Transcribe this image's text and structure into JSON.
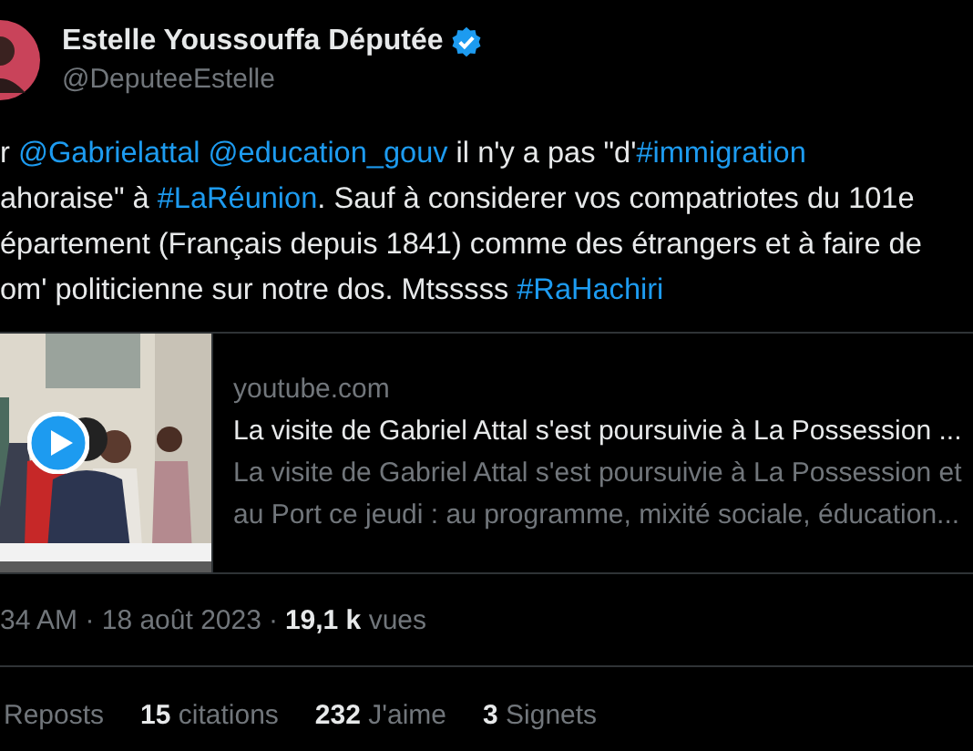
{
  "author": {
    "name": "Estelle Youssouffa Députée",
    "verified": true,
    "handle": "@DeputeeEstelle"
  },
  "tweet_lines": [
    [
      {
        "kind": "text",
        "text": "r "
      },
      {
        "kind": "mention",
        "text": "@Gabrielattal"
      },
      {
        "kind": "mention",
        "text": "@education_gouv"
      },
      {
        "kind": "text",
        "text": " il n'y a pas \"d'"
      },
      {
        "kind": "hashtag",
        "text": "#immigration"
      }
    ],
    [
      {
        "kind": "text",
        "text": "ahoraise\" à "
      },
      {
        "kind": "hashtag",
        "text": "#LaRéunion"
      },
      {
        "kind": "text",
        "text": ". Sauf à considerer vos compatriotes du 101e"
      }
    ],
    [
      {
        "kind": "text",
        "text": "épartement (Français depuis 1841) comme des étrangers et à faire de"
      }
    ],
    [
      {
        "kind": "text",
        "text": "om' politicienne sur notre dos. Mtsssss "
      },
      {
        "kind": "hashtag",
        "text": "#RaHachiri"
      }
    ]
  ],
  "link_card": {
    "media": {
      "kind": "picture"
    },
    "domain": "youtube.com",
    "title": "La visite de Gabriel Attal s'est poursuivie à La Possession ...",
    "description": [
      "La visite de Gabriel Attal s'est poursuivie à La Possession et",
      "au Port ce jeudi : au programme, mixité sociale, éducation..."
    ]
  },
  "meta": {
    "time": "34 AM · 18 août 2023",
    "separator": "·",
    "views": "**19,1 k** vues"
  },
  "stats": [
    "Reposts",
    "**15** citations",
    "**232** J'aime",
    "**3** Signets"
  ]
}
